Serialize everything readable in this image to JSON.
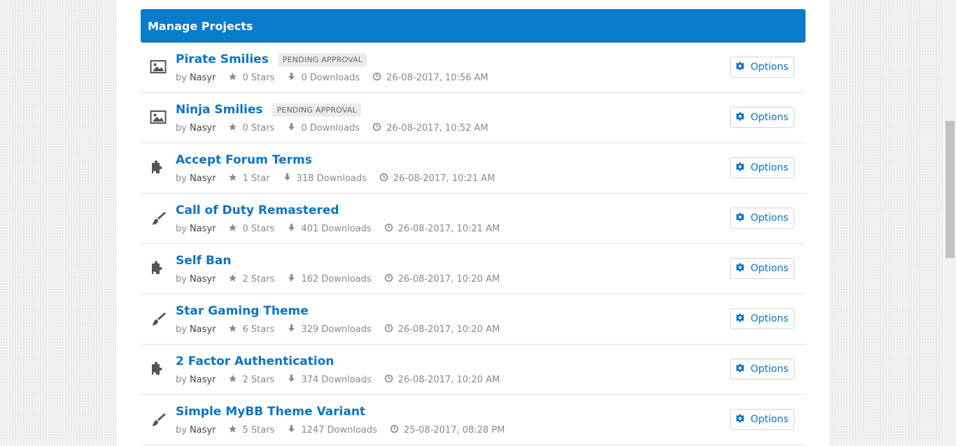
{
  "panel": {
    "title": "Manage Projects"
  },
  "labels": {
    "by": "by",
    "options": "Options"
  },
  "projects": [
    {
      "type_icon": "image-icon",
      "title": "Pirate Smilies",
      "badge": "PENDING APPROVAL",
      "author": "Nasyr",
      "stars": "0 Stars",
      "downloads": "0 Downloads",
      "date": "26-08-2017, 10:56 AM"
    },
    {
      "type_icon": "image-icon",
      "title": "Ninja Smilies",
      "badge": "PENDING APPROVAL",
      "author": "Nasyr",
      "stars": "0 Stars",
      "downloads": "0 Downloads",
      "date": "26-08-2017, 10:52 AM"
    },
    {
      "type_icon": "puzzle-icon",
      "title": "Accept Forum Terms",
      "badge": "",
      "author": "Nasyr",
      "stars": "1 Star",
      "downloads": "318 Downloads",
      "date": "26-08-2017, 10:21 AM"
    },
    {
      "type_icon": "brush-icon",
      "title": "Call of Duty Remastered",
      "badge": "",
      "author": "Nasyr",
      "stars": "0 Stars",
      "downloads": "401 Downloads",
      "date": "26-08-2017, 10:21 AM"
    },
    {
      "type_icon": "puzzle-icon",
      "title": "Self Ban",
      "badge": "",
      "author": "Nasyr",
      "stars": "2 Stars",
      "downloads": "162 Downloads",
      "date": "26-08-2017, 10:20 AM"
    },
    {
      "type_icon": "brush-icon",
      "title": "Star Gaming Theme",
      "badge": "",
      "author": "Nasyr",
      "stars": "6 Stars",
      "downloads": "329 Downloads",
      "date": "26-08-2017, 10:20 AM"
    },
    {
      "type_icon": "puzzle-icon",
      "title": "2 Factor Authentication",
      "badge": "",
      "author": "Nasyr",
      "stars": "2 Stars",
      "downloads": "374 Downloads",
      "date": "26-08-2017, 10:20 AM"
    },
    {
      "type_icon": "brush-icon",
      "title": "Simple MyBB Theme Variant",
      "badge": "",
      "author": "Nasyr",
      "stars": "5 Stars",
      "downloads": "1247 Downloads",
      "date": "25-08-2017, 08:28 PM"
    }
  ],
  "colors": {
    "header_bg": "#0a7ccc",
    "link": "#0a74c4",
    "badge_bg": "#ececec"
  }
}
